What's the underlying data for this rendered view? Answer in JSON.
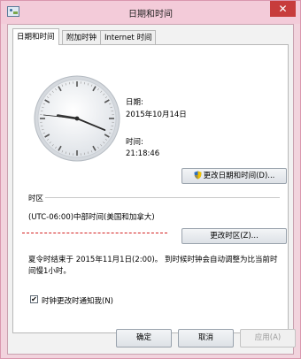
{
  "window": {
    "title": "日期和时间",
    "close_glyph": "✕"
  },
  "tabs": [
    {
      "label": "日期和时间",
      "active": true
    },
    {
      "label": "附加时钟",
      "active": false
    },
    {
      "label": "Internet 时间",
      "active": false
    }
  ],
  "clock": {
    "time": "21:18:46"
  },
  "date_section": {
    "date_label": "日期:",
    "date_value": "2015年10月14日",
    "time_label": "时间:",
    "time_value": "21:18:46",
    "change_datetime_button": "更改日期和时间(D)..."
  },
  "timezone_section": {
    "heading": "时区",
    "current": "(UTC-06:00)中部时间(美国和加拿大)",
    "change_timezone_button": "更改时区(Z)..."
  },
  "dst_notice": {
    "text": "夏令时结束于 2015年11月1日(2:00)。 到时候时钟会自动调整为比当前时间慢1小时。"
  },
  "notify_checkbox": {
    "label": "时钟更改时通知我(N)",
    "checked": true,
    "check_glyph": "✔"
  },
  "footer": {
    "ok": "确定",
    "cancel": "取消",
    "apply": "应用(A)"
  },
  "colors": {
    "accent_close": "#c73c3c",
    "annotation_dash": "#d42020",
    "window_frame": "#f2d3dd"
  }
}
